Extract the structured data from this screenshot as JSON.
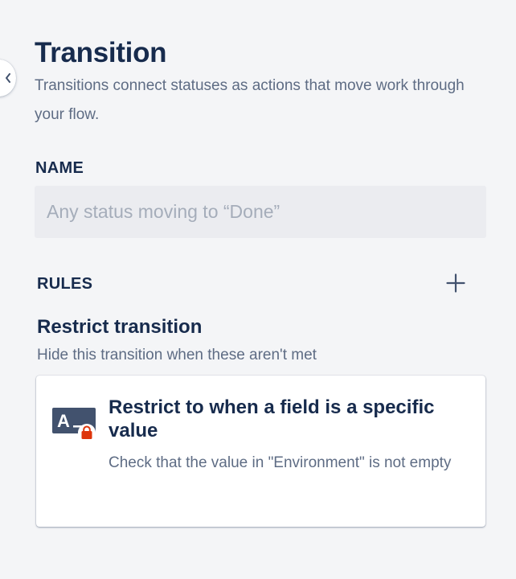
{
  "header": {
    "title": "Transition",
    "description": "Transitions connect statuses as actions that move work through your flow."
  },
  "name_field": {
    "label": "NAME",
    "value": "",
    "placeholder": "Any status moving to “Done”"
  },
  "rules": {
    "label": "RULES",
    "add_icon": "plus-icon",
    "groups": [
      {
        "title": "Restrict transition",
        "description": "Hide this transition when these aren't met",
        "items": [
          {
            "icon": "field-value-lock-icon",
            "title": "Restrict to when a field is a specific value",
            "description": "Check that the value in \"Environment\" is not empty"
          }
        ]
      }
    ]
  },
  "colors": {
    "background": "#f4f5f7",
    "text_primary": "#172b4d",
    "text_secondary": "#5e6c84",
    "input_background": "#ebecf0",
    "placeholder": "#a5adba",
    "icon_navy": "#42526e",
    "lock_red": "#de350b"
  }
}
